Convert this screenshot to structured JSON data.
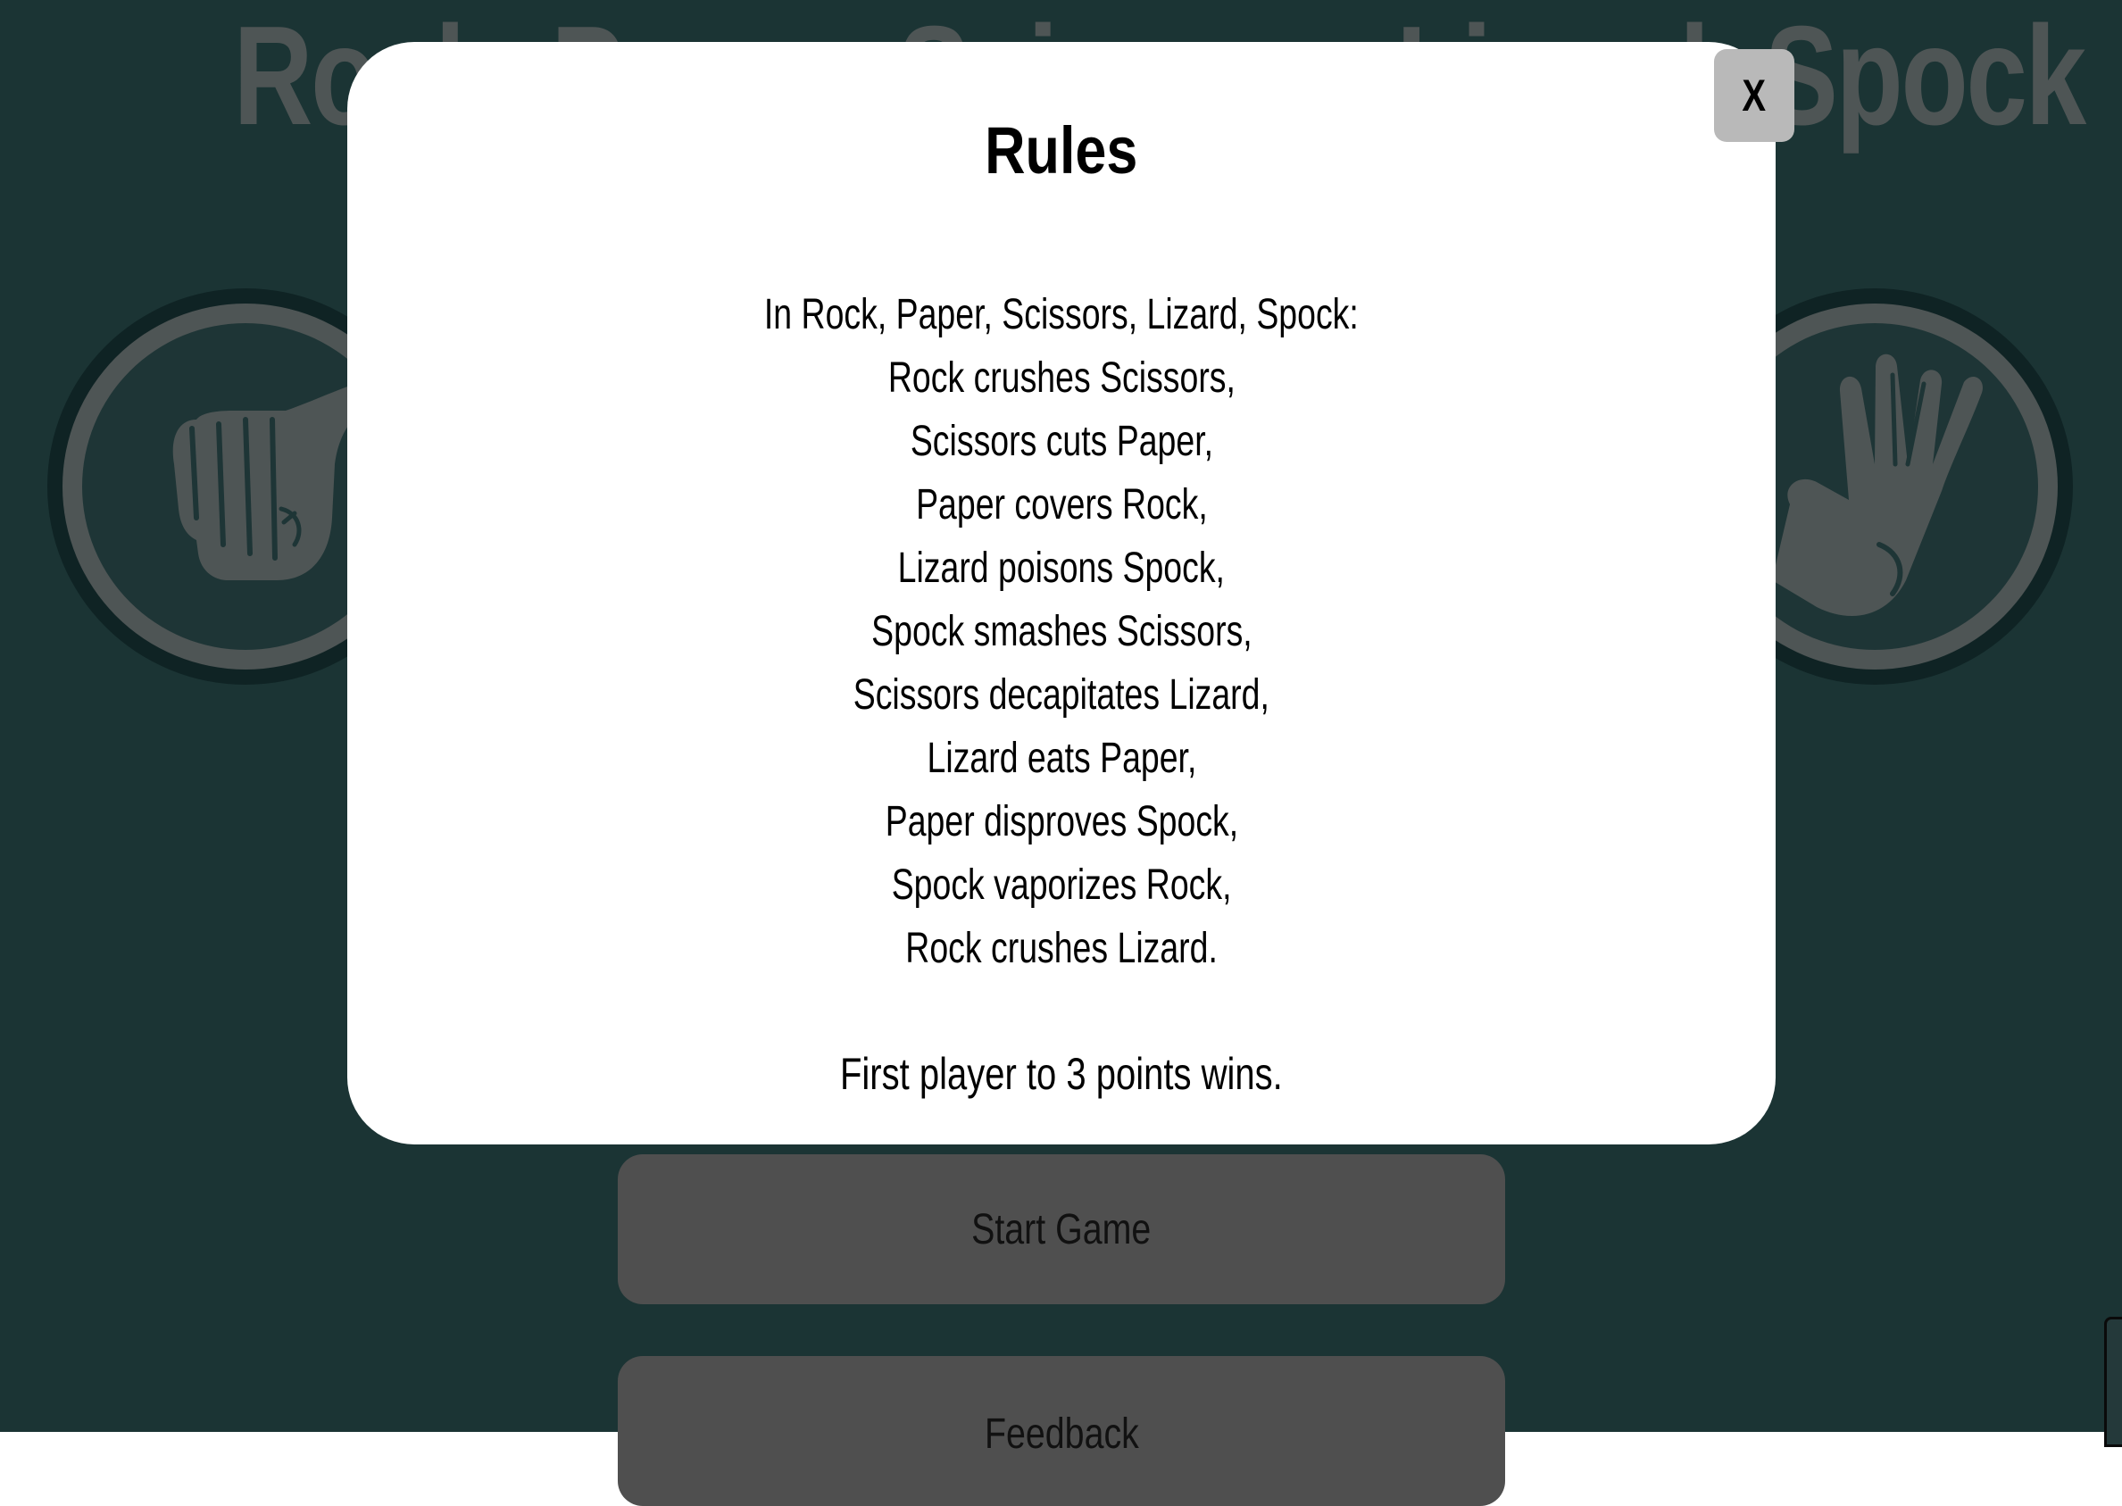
{
  "page": {
    "title": "Rock, Paper, Scissors, Lizard, Spock",
    "hands": {
      "left_icon": "rock-fist-icon",
      "right_icon": "spock-hand-icon"
    },
    "buttons": {
      "start": "Start Game",
      "feedback": "Feedback"
    }
  },
  "modal": {
    "title": "Rules",
    "close_label": "X",
    "rules": [
      "In Rock, Paper, Scissors, Lizard, Spock:",
      "Rock crushes Scissors,",
      "Scissors cuts Paper,",
      "Paper covers Rock,",
      "Lizard poisons Spock,",
      "Spock smashes Scissors,",
      "Scissors decapitates Lizard,",
      "Lizard eats Paper,",
      "Paper disproves Spock,",
      "Spock vaporizes Rock,",
      "Rock crushes Lizard."
    ],
    "win_condition": "First player to 3 points wins."
  },
  "colors": {
    "overlay_background": "#1b3434",
    "modal_background": "#ffffff",
    "close_button": "#b9b9b9",
    "menu_button": "#4f4f4f"
  }
}
